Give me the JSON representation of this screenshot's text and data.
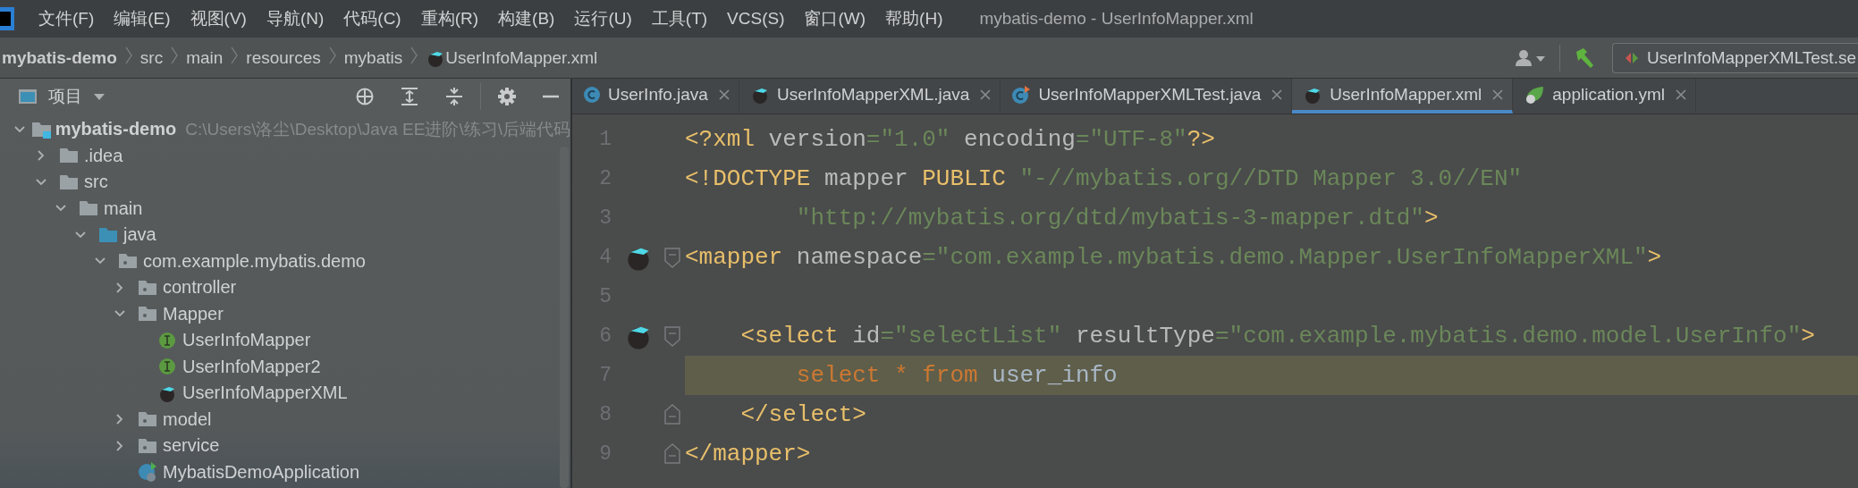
{
  "menubar": {
    "items": [
      "文件(F)",
      "编辑(E)",
      "视图(V)",
      "导航(N)",
      "代码(C)",
      "重构(R)",
      "构建(B)",
      "运行(U)",
      "工具(T)",
      "VCS(S)",
      "窗口(W)",
      "帮助(H)"
    ],
    "title": "mybatis-demo - UserInfoMapper.xml"
  },
  "breadcrumb": [
    "mybatis-demo",
    "src",
    "main",
    "resources",
    "mybatis",
    "UserInfoMapper.xml"
  ],
  "run_config": {
    "label": "UserInfoMapperXMLTest.se"
  },
  "project_panel": {
    "title": "项目",
    "tree": [
      {
        "label": "mybatis-demo",
        "kind": "module",
        "path": "C:\\Users\\洛尘\\Desktop\\Java EE进阶\\练习\\后端代码",
        "expanded": true,
        "children": [
          {
            "label": ".idea",
            "kind": "folder",
            "expanded": false
          },
          {
            "label": "src",
            "kind": "folder",
            "expanded": true,
            "children": [
              {
                "label": "main",
                "kind": "folder",
                "expanded": true,
                "children": [
                  {
                    "label": "java",
                    "kind": "source",
                    "expanded": true,
                    "children": [
                      {
                        "label": "com.example.mybatis.demo",
                        "kind": "package",
                        "expanded": true,
                        "children": [
                          {
                            "label": "controller",
                            "kind": "package",
                            "expanded": false
                          },
                          {
                            "label": "Mapper",
                            "kind": "package",
                            "expanded": true,
                            "children": [
                              {
                                "label": "UserInfoMapper",
                                "kind": "interface"
                              },
                              {
                                "label": "UserInfoMapper2",
                                "kind": "interface"
                              },
                              {
                                "label": "UserInfoMapperXML",
                                "kind": "mapper"
                              }
                            ]
                          },
                          {
                            "label": "model",
                            "kind": "package",
                            "expanded": false
                          },
                          {
                            "label": "service",
                            "kind": "package",
                            "expanded": false
                          },
                          {
                            "label": "MybatisDemoApplication",
                            "kind": "spring"
                          }
                        ]
                      }
                    ]
                  }
                ]
              }
            ]
          }
        ]
      }
    ]
  },
  "tabs": [
    {
      "label": "UserInfo.java",
      "kind": "class",
      "selected": false
    },
    {
      "label": "UserInfoMapperXML.java",
      "kind": "mapper",
      "selected": false
    },
    {
      "label": "UserInfoMapperXMLTest.java",
      "kind": "test",
      "selected": false
    },
    {
      "label": "UserInfoMapper.xml",
      "kind": "mapper",
      "selected": true
    },
    {
      "label": "application.yml",
      "kind": "yaml",
      "selected": false
    }
  ],
  "editor": {
    "lines": [
      {
        "number": "1",
        "tokens": [
          {
            "kind": "tag",
            "text": "<?xml"
          },
          {
            "kind": "attr",
            "text": " version"
          },
          {
            "kind": "str",
            "text": "=\"1.0\""
          },
          {
            "kind": "attr",
            "text": " encoding"
          },
          {
            "kind": "str",
            "text": "=\"UTF-8\""
          },
          {
            "kind": "tag",
            "text": "?>"
          }
        ]
      },
      {
        "number": "2",
        "tokens": [
          {
            "kind": "tag",
            "text": "<!DOCTYPE"
          },
          {
            "kind": "attr",
            "text": " mapper"
          },
          {
            "kind": "tag",
            "text": " PUBLIC"
          },
          {
            "kind": "str",
            "text": " \"-//mybatis.org//DTD Mapper 3.0//EN\""
          }
        ]
      },
      {
        "number": "3",
        "tokens": [
          {
            "kind": "str",
            "text": "        \"http://mybatis.org/dtd/mybatis-3-mapper.dtd\""
          },
          {
            "kind": "tag",
            "text": ">"
          }
        ]
      },
      {
        "number": "4",
        "gutter": {
          "kind": "mapper"
        },
        "fold_marker": {
          "kind": "start"
        },
        "tokens": [
          {
            "kind": "tag",
            "text": "<mapper"
          },
          {
            "kind": "attr",
            "text": " namespace"
          },
          {
            "kind": "str",
            "text": "=\"com.example.mybatis.demo.Mapper.UserInfoMapperXML\""
          },
          {
            "kind": "tag",
            "text": ">"
          }
        ]
      },
      {
        "number": "5"
      },
      {
        "number": "6",
        "gutter": {
          "kind": "mapper"
        },
        "fold_marker": {
          "kind": "start"
        },
        "tokens": [
          {
            "kind": "tag",
            "text": "    <select"
          },
          {
            "kind": "attr",
            "text": " id"
          },
          {
            "kind": "str",
            "text": "=\"selectList\""
          },
          {
            "kind": "attr",
            "text": " resultType"
          },
          {
            "kind": "str",
            "text": "=\"com.example.mybatis.demo.model.UserInfo\""
          },
          {
            "kind": "tag",
            "text": ">"
          }
        ]
      },
      {
        "number": "7",
        "highlighted": true,
        "tokens": [
          {
            "kind": "kw",
            "text": "        select"
          },
          {
            "kind": "kw",
            "text": " *"
          },
          {
            "kind": "kw",
            "text": " from"
          },
          {
            "kind": "plain",
            "text": " user_info"
          }
        ]
      },
      {
        "number": "8",
        "fold_marker": {
          "kind": "end"
        },
        "tokens": [
          {
            "kind": "tag",
            "text": "    </select>"
          }
        ]
      },
      {
        "number": "9",
        "fold_marker": {
          "kind": "end"
        },
        "tokens": [
          {
            "kind": "tag",
            "text": "</mapper>"
          }
        ]
      }
    ]
  }
}
